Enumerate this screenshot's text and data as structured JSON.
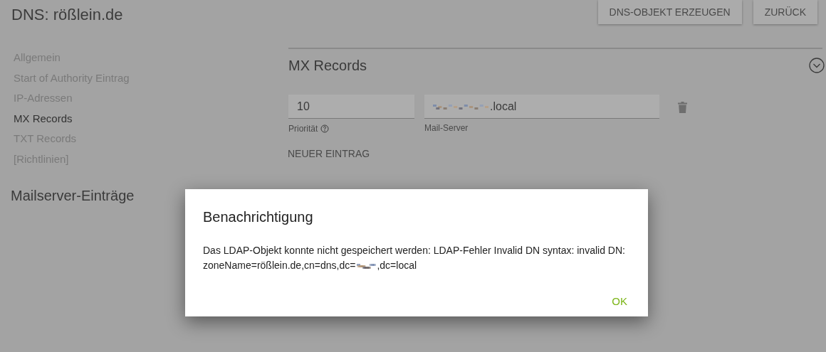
{
  "header": {
    "title": "DNS: rößlein.de",
    "buttons": [
      "DNS-OBJEKT ERZEUGEN",
      "ZURÜCK"
    ]
  },
  "sidebar": {
    "items": [
      {
        "label": "Allgemein",
        "selected": false
      },
      {
        "label": "Start of Authority Eintrag",
        "selected": false
      },
      {
        "label": "IP-Adressen",
        "selected": false
      },
      {
        "label": "MX Records",
        "selected": true
      },
      {
        "label": "TXT Records",
        "selected": false
      },
      {
        "label": "[Richtlinien]",
        "selected": false
      }
    ],
    "heading": "Mailserver-Einträge"
  },
  "section": {
    "title": "MX Records",
    "records": [
      {
        "priority": "10",
        "priority_label": "Priorität",
        "mail_server": ".local",
        "mail_server_label": "Mail-Server"
      }
    ],
    "add_button": "NEUER EINTRAG"
  },
  "dialog": {
    "title": "Benachrichtigung",
    "message": "Das LDAP-Objekt konnte nicht gespeichert werden: LDAP-Fehler Invalid DN syntax: invalid DN:",
    "message_dn": "zoneName=rößlein.de,cn=dns,dc=",
    "message_end": ",dc=local",
    "button": "OK"
  }
}
